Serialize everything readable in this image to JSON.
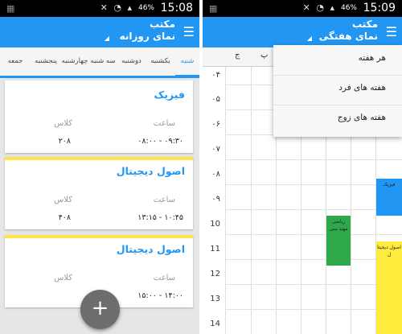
{
  "left": {
    "status": {
      "time": "15:08",
      "battery": "46%"
    },
    "appbar": {
      "title_line1": "مکتب",
      "title_line2": "نمای روزانه"
    },
    "tabs": [
      "شنبه",
      "یکشنبه",
      "دوشنبه",
      "سه شنبه",
      "چهارشنبه",
      "پنجشنبه",
      "جمعه"
    ],
    "cards": [
      {
        "title": "فیزیک",
        "time_label": "ساعت",
        "class_label": "کلاس",
        "time": "۰۸:۰۰ - ۰۹:۳۰",
        "room": "۲۰۸"
      },
      {
        "title": "اصول دیجیتال",
        "time_label": "ساعت",
        "class_label": "کلاس",
        "time": "۱۳:۱۵ - ۱۰:۴۵",
        "room": "۴۰۸"
      },
      {
        "title": "اصول دیجیتال",
        "time_label": "ساعت",
        "class_label": "کلاس",
        "time": "۱۵:۰۰ - ۱۴:۰۰",
        "room": ""
      }
    ],
    "fab_label": "+"
  },
  "right": {
    "status": {
      "time": "15:09",
      "battery": "46%"
    },
    "appbar": {
      "title_line1": "مکتب",
      "title_line2": "نمای هفتگی"
    },
    "grid_headers": [
      "ج",
      "پ"
    ],
    "hours": [
      "۰۴",
      "۰۵",
      "۰۶",
      "۰۷",
      "۰۸",
      "۰۹",
      "10",
      "11",
      "12",
      "13",
      "14"
    ],
    "blocks": [
      {
        "text": "ریاضی مهند سی",
        "color": "#2ea84a"
      },
      {
        "text": "فیزیک",
        "color": "#2196f3"
      },
      {
        "text": "اصول دیجیتا ل",
        "color": "#ffeb3b"
      }
    ],
    "dropdown": {
      "items": [
        "هر هفته",
        "هفته های فرد",
        "هفته های زوج"
      ]
    }
  },
  "colors": {
    "accent": "#2196f3",
    "card_stripe": "#ffe44d",
    "fab": "#6d6d6d"
  }
}
